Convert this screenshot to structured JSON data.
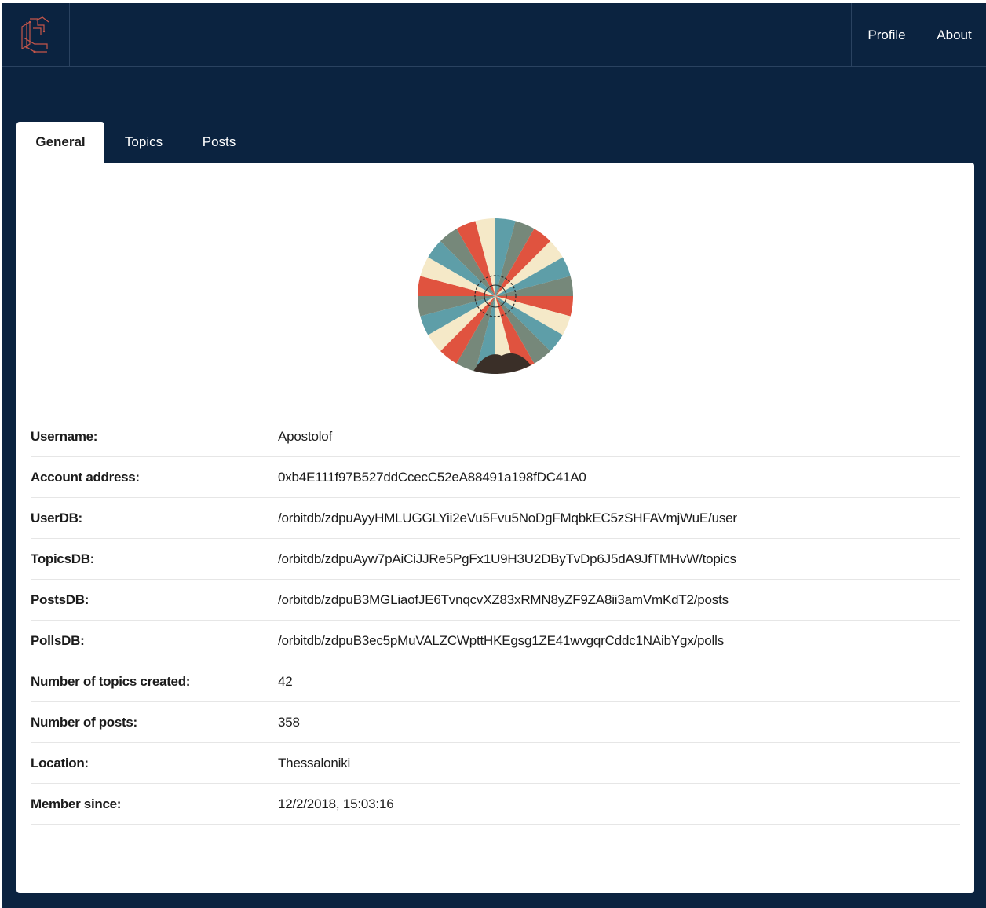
{
  "nav": {
    "logo_icon": "forum-logo-icon",
    "profile_label": "Profile",
    "about_label": "About"
  },
  "tabs": [
    {
      "label": "General",
      "active": true
    },
    {
      "label": "Topics",
      "active": false
    },
    {
      "label": "Posts",
      "active": false
    }
  ],
  "profile": {
    "avatar_icon": "pinwheel-avatar-icon",
    "details": [
      {
        "label": "Username:",
        "value": "Apostolof"
      },
      {
        "label": "Account address:",
        "value": "0xb4E111f97B527ddCcecC52eA88491a198fDC41A0"
      },
      {
        "label": "UserDB:",
        "value": "/orbitdb/zdpuAyyHMLUGGLYii2eVu5Fvu5NoDgFMqbkEC5zSHFAVmjWuE/user"
      },
      {
        "label": "TopicsDB:",
        "value": "/orbitdb/zdpuAyw7pAiCiJJRe5PgFx1U9H3U2DByTvDp6J5dA9JfTMHvW/topics"
      },
      {
        "label": "PostsDB:",
        "value": "/orbitdb/zdpuB3MGLiaofJE6TvnqcvXZ83xRMN8yZF9ZA8ii3amVmKdT2/posts"
      },
      {
        "label": "PollsDB:",
        "value": "/orbitdb/zdpuB3ec5pMuVALZCWpttHKEgsg1ZE41wvgqrCddc1NAibYgx/polls"
      },
      {
        "label": "Number of topics created:",
        "value": "42"
      },
      {
        "label": "Number of posts:",
        "value": "358"
      },
      {
        "label": "Location:",
        "value": "Thessaloniki"
      },
      {
        "label": "Member since:",
        "value": "12/2/2018, 15:03:16"
      }
    ]
  },
  "colors": {
    "background": "#0b2340",
    "panel": "#ffffff",
    "avatar_red": "#e0533f",
    "avatar_teal": "#5e9ea8",
    "avatar_cream": "#f5e9c8",
    "avatar_olive": "#76887a"
  }
}
